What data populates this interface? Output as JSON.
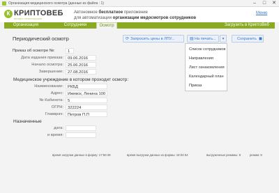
{
  "window": {
    "title": "Организация медицинского осмотра (данные из файла : 1)",
    "minimize": "–",
    "maximize": "□",
    "close": "✕"
  },
  "brand": {
    "logo_text": "КРИПТОВЕБ",
    "logo_sub": "БИЗНЕС ПРИЛОЖЕНИЯ",
    "tagline_prefix": "Автономное ",
    "tagline_bold1": "бесплатное",
    "tagline_suffix": " приложение",
    "tagline2_prefix": "для автоматизации ",
    "tagline2_bold": "организации медосмотров сотрудников",
    "menu_link": "Меню",
    "accent": "#8aaa24"
  },
  "nav": {
    "tabs": [
      {
        "label": "Организация"
      },
      {
        "label": "Сотрудники"
      },
      {
        "label": "Осмотр"
      }
    ],
    "active_tab": "Осмотр",
    "upload_label": "Загрузить в КриптоВеб"
  },
  "page": {
    "title": "Периодический осмотр"
  },
  "toolbar": {
    "request_prices": "Запросить цены в ЛПУ...",
    "print": "На печать...",
    "save": "Сохранить"
  },
  "print_menu": {
    "items": [
      "Список сотрудников",
      "Направления",
      "Лист ознакомления",
      "Календарный план",
      "Приказ"
    ]
  },
  "order": {
    "number_label": "Приказ об осмотре №:",
    "number": "1",
    "date_label": "Дата издания приказа:",
    "date": "09.06.2016",
    "start_label": "Начало осмотра:",
    "start": "25.06.2016",
    "end_label": "Завершение:",
    "end": "27.08.2016"
  },
  "institution": {
    "section_title": "Медицинское учреждение в котором проходит осмотр:",
    "name_label": "Наименование:",
    "name": "РКБД",
    "address_label": "Адрес:",
    "address": "Ижевск, Ленина 100",
    "office_label": "№ Кабинета:",
    "office": "5",
    "ogrn_label": "ОГРН:",
    "ogrn": "322224",
    "chief_label": "Главврач:",
    "chief": "Петров П.П"
  },
  "assigned": {
    "section_title": "Назначенные",
    "date_label": "дата:",
    "date": "",
    "time_label": "и время:",
    "time": ""
  },
  "status": {
    "load_time": "время загрузки данных в форму: 17:50:49",
    "unload_time": "время выгрузки данных из формы: 18:04:54",
    "unload_mode": "выгруженные режимы: 8",
    "mode": "режим: 8"
  }
}
